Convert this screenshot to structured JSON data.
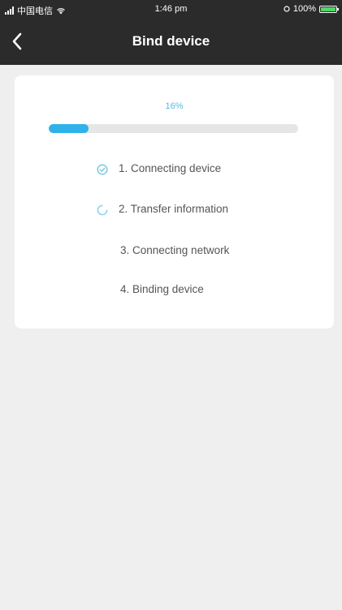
{
  "status_bar": {
    "carrier": "中国电信",
    "time": "1:46 pm",
    "battery": "100%"
  },
  "nav": {
    "title": "Bind device",
    "back_icon": "chevron-left-icon"
  },
  "progress": {
    "percent_label": "16%",
    "value": 0.16
  },
  "steps": [
    {
      "label": "1. Connecting device",
      "status": "done",
      "icon": "check-circle-icon"
    },
    {
      "label": "2. Transfer information",
      "status": "loading",
      "icon": "spinner-icon"
    },
    {
      "label": "3. Connecting network",
      "status": "pending",
      "icon": ""
    },
    {
      "label": "4. Binding device",
      "status": "pending",
      "icon": ""
    }
  ],
  "colors": {
    "nav_background": "#2b2b2b",
    "accent": "#2fb2eb",
    "page_background": "#efefef"
  }
}
